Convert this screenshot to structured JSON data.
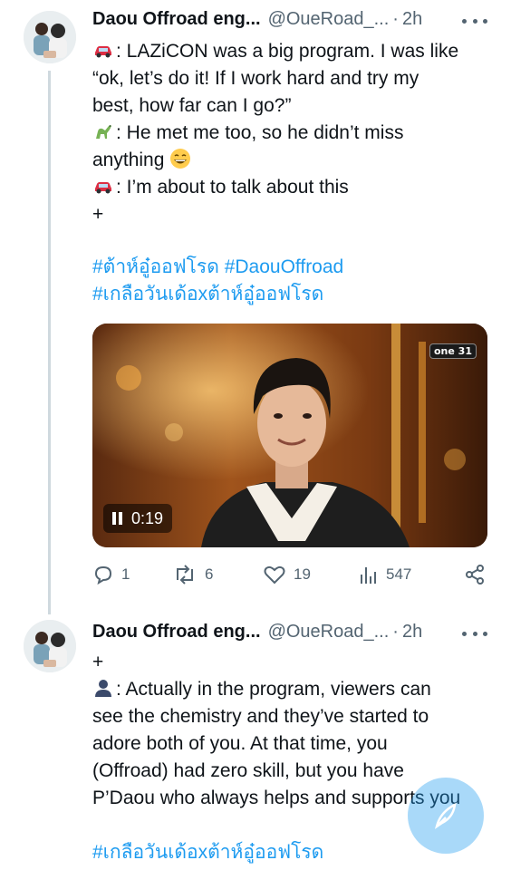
{
  "thread": {
    "tweets": [
      {
        "author": "Daou Offroad eng...",
        "handle": "@OueRoad_...",
        "separator": "·",
        "time": "2h",
        "lines": [
          {
            "icon": "car-emoji",
            "text": ": LAZiCON was a big program. I was like"
          },
          {
            "text": "“ok, let’s do it! If I work hard and try my"
          },
          {
            "text": "best, how far can I go?”"
          },
          {
            "icon": "dinosaur-emoji",
            "text": ": He met me too, so he didn’t miss"
          },
          {
            "text": "anything",
            "trail_icon": "grinning-emoji"
          },
          {
            "icon": "car-emoji",
            "text": ": I’m about to talk about this"
          },
          {
            "text": "+"
          }
        ],
        "hashtags": [
          "#ต้าห์อู๋ออฟโรด #DaouOffroad",
          "#เกลือวันเด้อxต้าห์อู๋ออฟโรด"
        ],
        "video": {
          "duration": "0:19",
          "channel": "one 31"
        },
        "metrics": {
          "replies": "1",
          "reposts": "6",
          "likes": "19",
          "views": "547"
        }
      },
      {
        "author": "Daou Offroad eng...",
        "handle": "@OueRoad_...",
        "separator": "·",
        "time": "2h",
        "lines": [
          {
            "text": "+"
          },
          {
            "icon": "person-silhouette-emoji",
            "text": ": Actually in the program, viewers can"
          },
          {
            "text": "see the chemistry and they’ve started to"
          },
          {
            "text": "adore both of you. At that time, you"
          },
          {
            "text": "(Offroad) had zero skill, but you have"
          },
          {
            "text": "P’Daou who always helps and supports you"
          }
        ],
        "hashtags": [
          "#เกลือวันเด้อxต้าห์อู๋ออฟโรด"
        ]
      }
    ]
  },
  "compose_button": {
    "icon": "feather-plus-icon"
  },
  "colors": {
    "accent": "#1d9bf0",
    "text": "#0f1419",
    "muted": "#536471"
  }
}
